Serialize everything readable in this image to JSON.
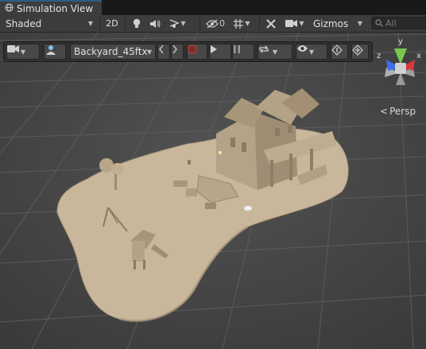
{
  "window": {
    "tab_title": "Simulation View",
    "tab_icon": "globe-icon"
  },
  "toolbar": {
    "draw_mode": "Shaded",
    "mode_2d": "2D",
    "hidden_count": "0",
    "gizmos_label": "Gizmos",
    "search_placeholder": "All"
  },
  "sim_toolbar": {
    "scene_name": "Backyard_45ftx",
    "icons": [
      "camera-icon",
      "agent-icon",
      "prev-icon",
      "next-icon",
      "record-icon",
      "play-icon",
      "pause-icon",
      "loop-icon",
      "eye-icon",
      "info-icon",
      "target-icon"
    ]
  },
  "orientation": {
    "label": "Persp",
    "x": "x",
    "y": "y",
    "z": "z"
  },
  "colors": {
    "accent": "#2c5d87",
    "gizmo_x": "#d9383a",
    "gizmo_y": "#7ac74c",
    "gizmo_z": "#3e6ee8",
    "terrain": "#c8b79a"
  }
}
